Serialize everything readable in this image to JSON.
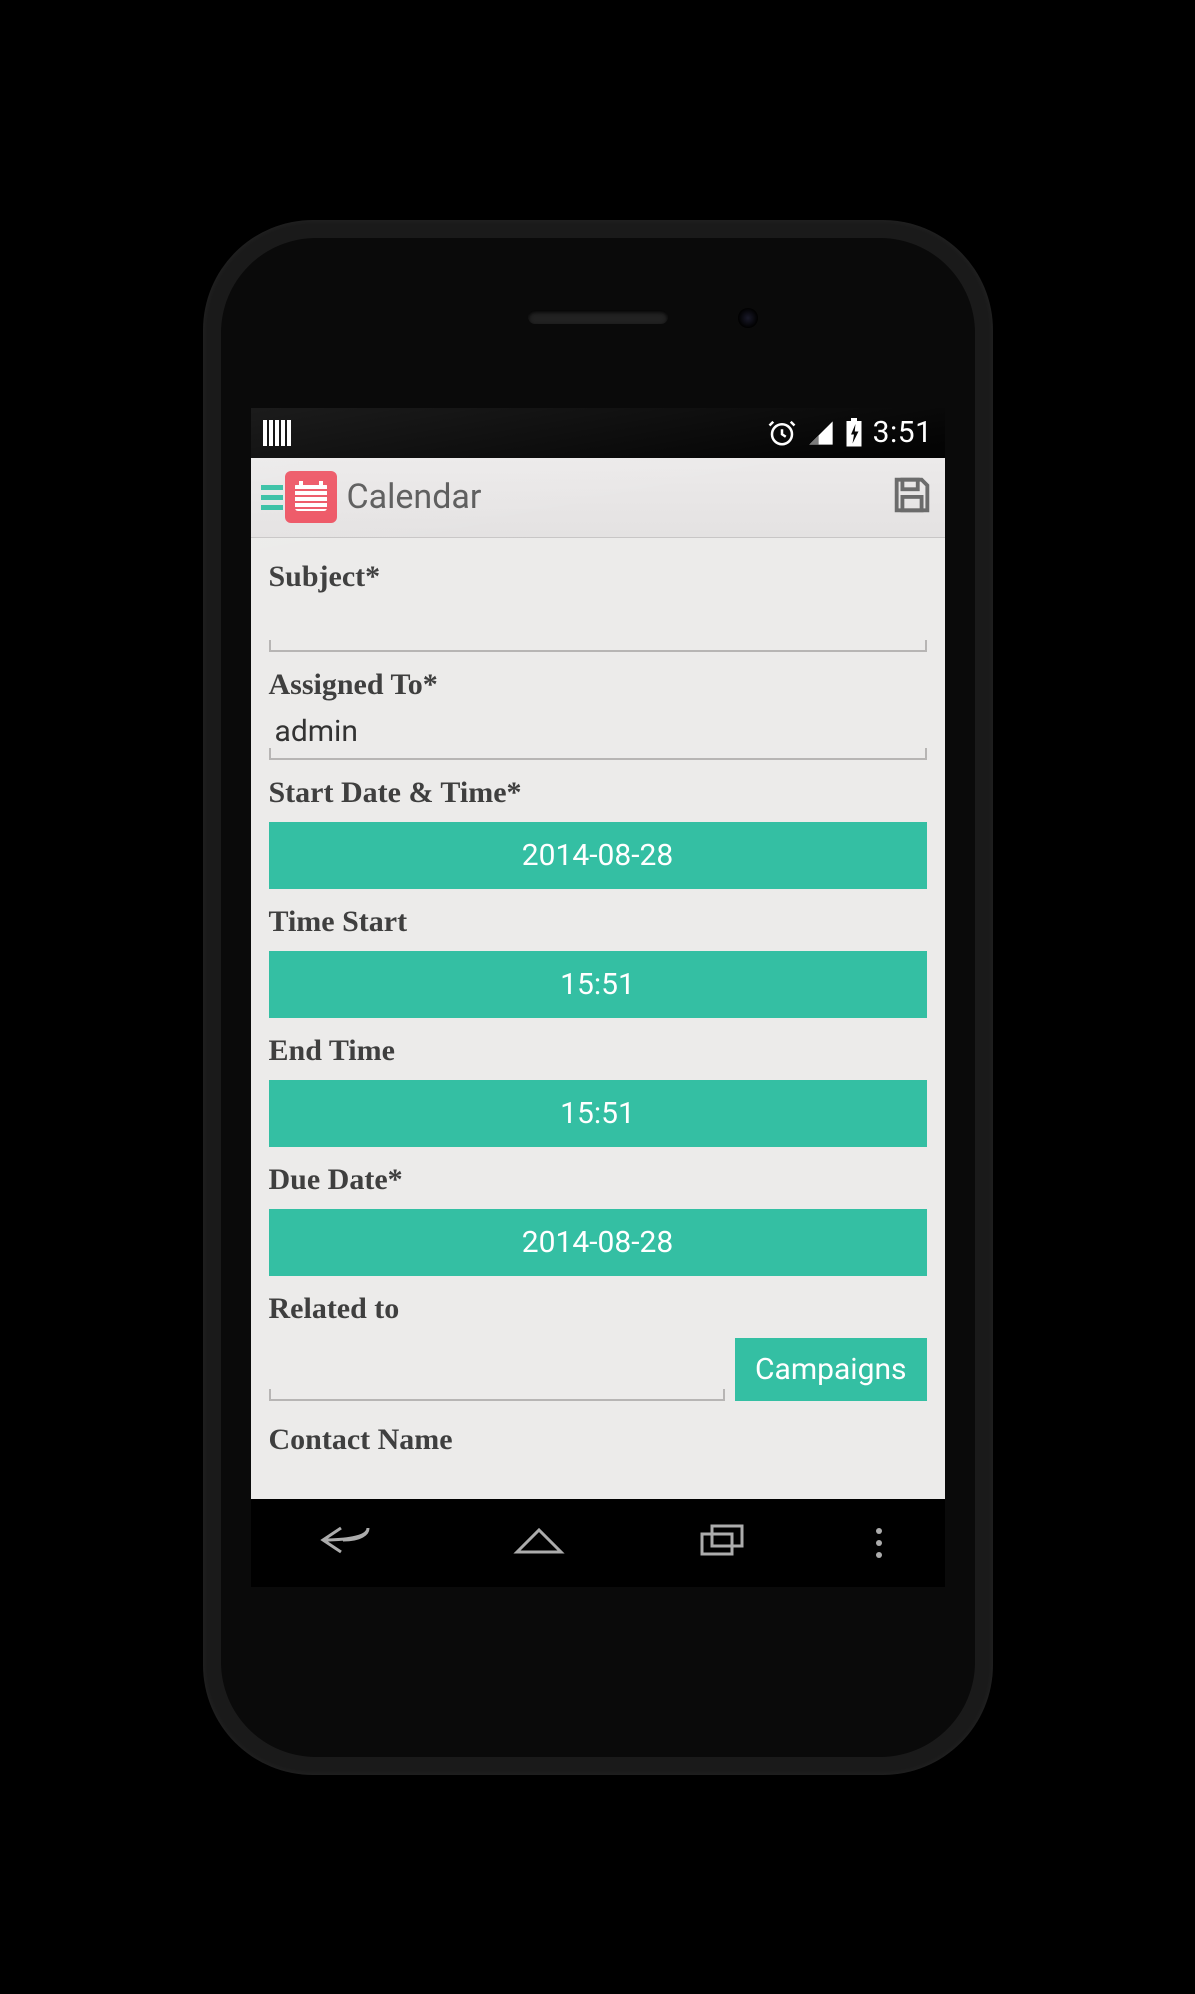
{
  "status": {
    "time": "3:51"
  },
  "appbar": {
    "title": "Calendar"
  },
  "form": {
    "subject_label": "Subject*",
    "subject_value": "",
    "assigned_label": "Assigned To*",
    "assigned_value": "admin",
    "start_dt_label": "Start Date & Time*",
    "start_date": "2014-08-28",
    "time_start_label": "Time Start",
    "time_start": "15:51",
    "end_time_label": "End Time",
    "end_time": "15:51",
    "due_date_label": "Due Date*",
    "due_date": "2014-08-28",
    "related_label": "Related to",
    "related_value": "",
    "related_type": "Campaigns",
    "contact_label": "Contact Name"
  },
  "colors": {
    "accent": "#34bfa3",
    "cal_icon": "#ed5564"
  }
}
